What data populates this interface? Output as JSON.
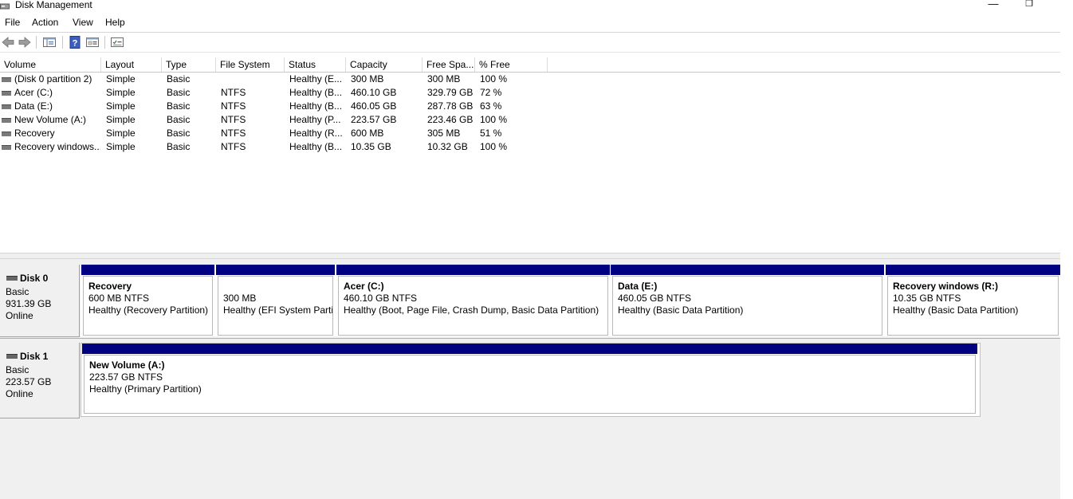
{
  "window": {
    "title": "Disk Management",
    "minimize_glyph": "—",
    "restore_glyph": "❐"
  },
  "menu": [
    "File",
    "Action",
    "View",
    "Help"
  ],
  "toolbar": {
    "icons": [
      "back-arrow-icon",
      "forward-arrow-icon",
      "console-tree-icon",
      "help-icon",
      "properties-icon",
      "show-list-icon"
    ]
  },
  "volume_list": {
    "columns": [
      "Volume",
      "Layout",
      "Type",
      "File System",
      "Status",
      "Capacity",
      "Free Spa...",
      "% Free"
    ],
    "rows": [
      {
        "volume": "(Disk 0 partition 2)",
        "layout": "Simple",
        "type": "Basic",
        "fs": "",
        "status": "Healthy (E...",
        "capacity": "300 MB",
        "free": "300 MB",
        "pct": "100 %"
      },
      {
        "volume": "Acer (C:)",
        "layout": "Simple",
        "type": "Basic",
        "fs": "NTFS",
        "status": "Healthy (B...",
        "capacity": "460.10 GB",
        "free": "329.79 GB",
        "pct": "72 %"
      },
      {
        "volume": "Data (E:)",
        "layout": "Simple",
        "type": "Basic",
        "fs": "NTFS",
        "status": "Healthy (B...",
        "capacity": "460.05 GB",
        "free": "287.78 GB",
        "pct": "63 %"
      },
      {
        "volume": "New Volume (A:)",
        "layout": "Simple",
        "type": "Basic",
        "fs": "NTFS",
        "status": "Healthy (P...",
        "capacity": "223.57 GB",
        "free": "223.46 GB",
        "pct": "100 %"
      },
      {
        "volume": "Recovery",
        "layout": "Simple",
        "type": "Basic",
        "fs": "NTFS",
        "status": "Healthy (R...",
        "capacity": "600 MB",
        "free": "305 MB",
        "pct": "51 %"
      },
      {
        "volume": "Recovery windows...",
        "layout": "Simple",
        "type": "Basic",
        "fs": "NTFS",
        "status": "Healthy (B...",
        "capacity": "10.35 GB",
        "free": "10.32 GB",
        "pct": "100 %"
      }
    ]
  },
  "disks": [
    {
      "name": "Disk 0",
      "type": "Basic",
      "size": "931.39 GB",
      "state": "Online",
      "partitions": [
        {
          "name": "Recovery",
          "size": "600 MB NTFS",
          "status": "Healthy (Recovery Partition)"
        },
        {
          "name": "",
          "size": "300 MB",
          "status": "Healthy (EFI System Partit"
        },
        {
          "name": "Acer  (C:)",
          "size": "460.10 GB NTFS",
          "status": "Healthy (Boot, Page File, Crash Dump, Basic Data Partition)"
        },
        {
          "name": "Data  (E:)",
          "size": "460.05 GB NTFS",
          "status": "Healthy (Basic Data Partition)"
        },
        {
          "name": "Recovery windows  (R:)",
          "size": "10.35 GB NTFS",
          "status": "Healthy (Basic Data Partition)"
        }
      ]
    },
    {
      "name": "Disk 1",
      "type": "Basic",
      "size": "223.57 GB",
      "state": "Online",
      "partitions": [
        {
          "name": "New Volume  (A:)",
          "size": "223.57 GB NTFS",
          "status": "Healthy (Primary Partition)"
        }
      ]
    }
  ],
  "colors": {
    "partition_bar": "#000080"
  }
}
